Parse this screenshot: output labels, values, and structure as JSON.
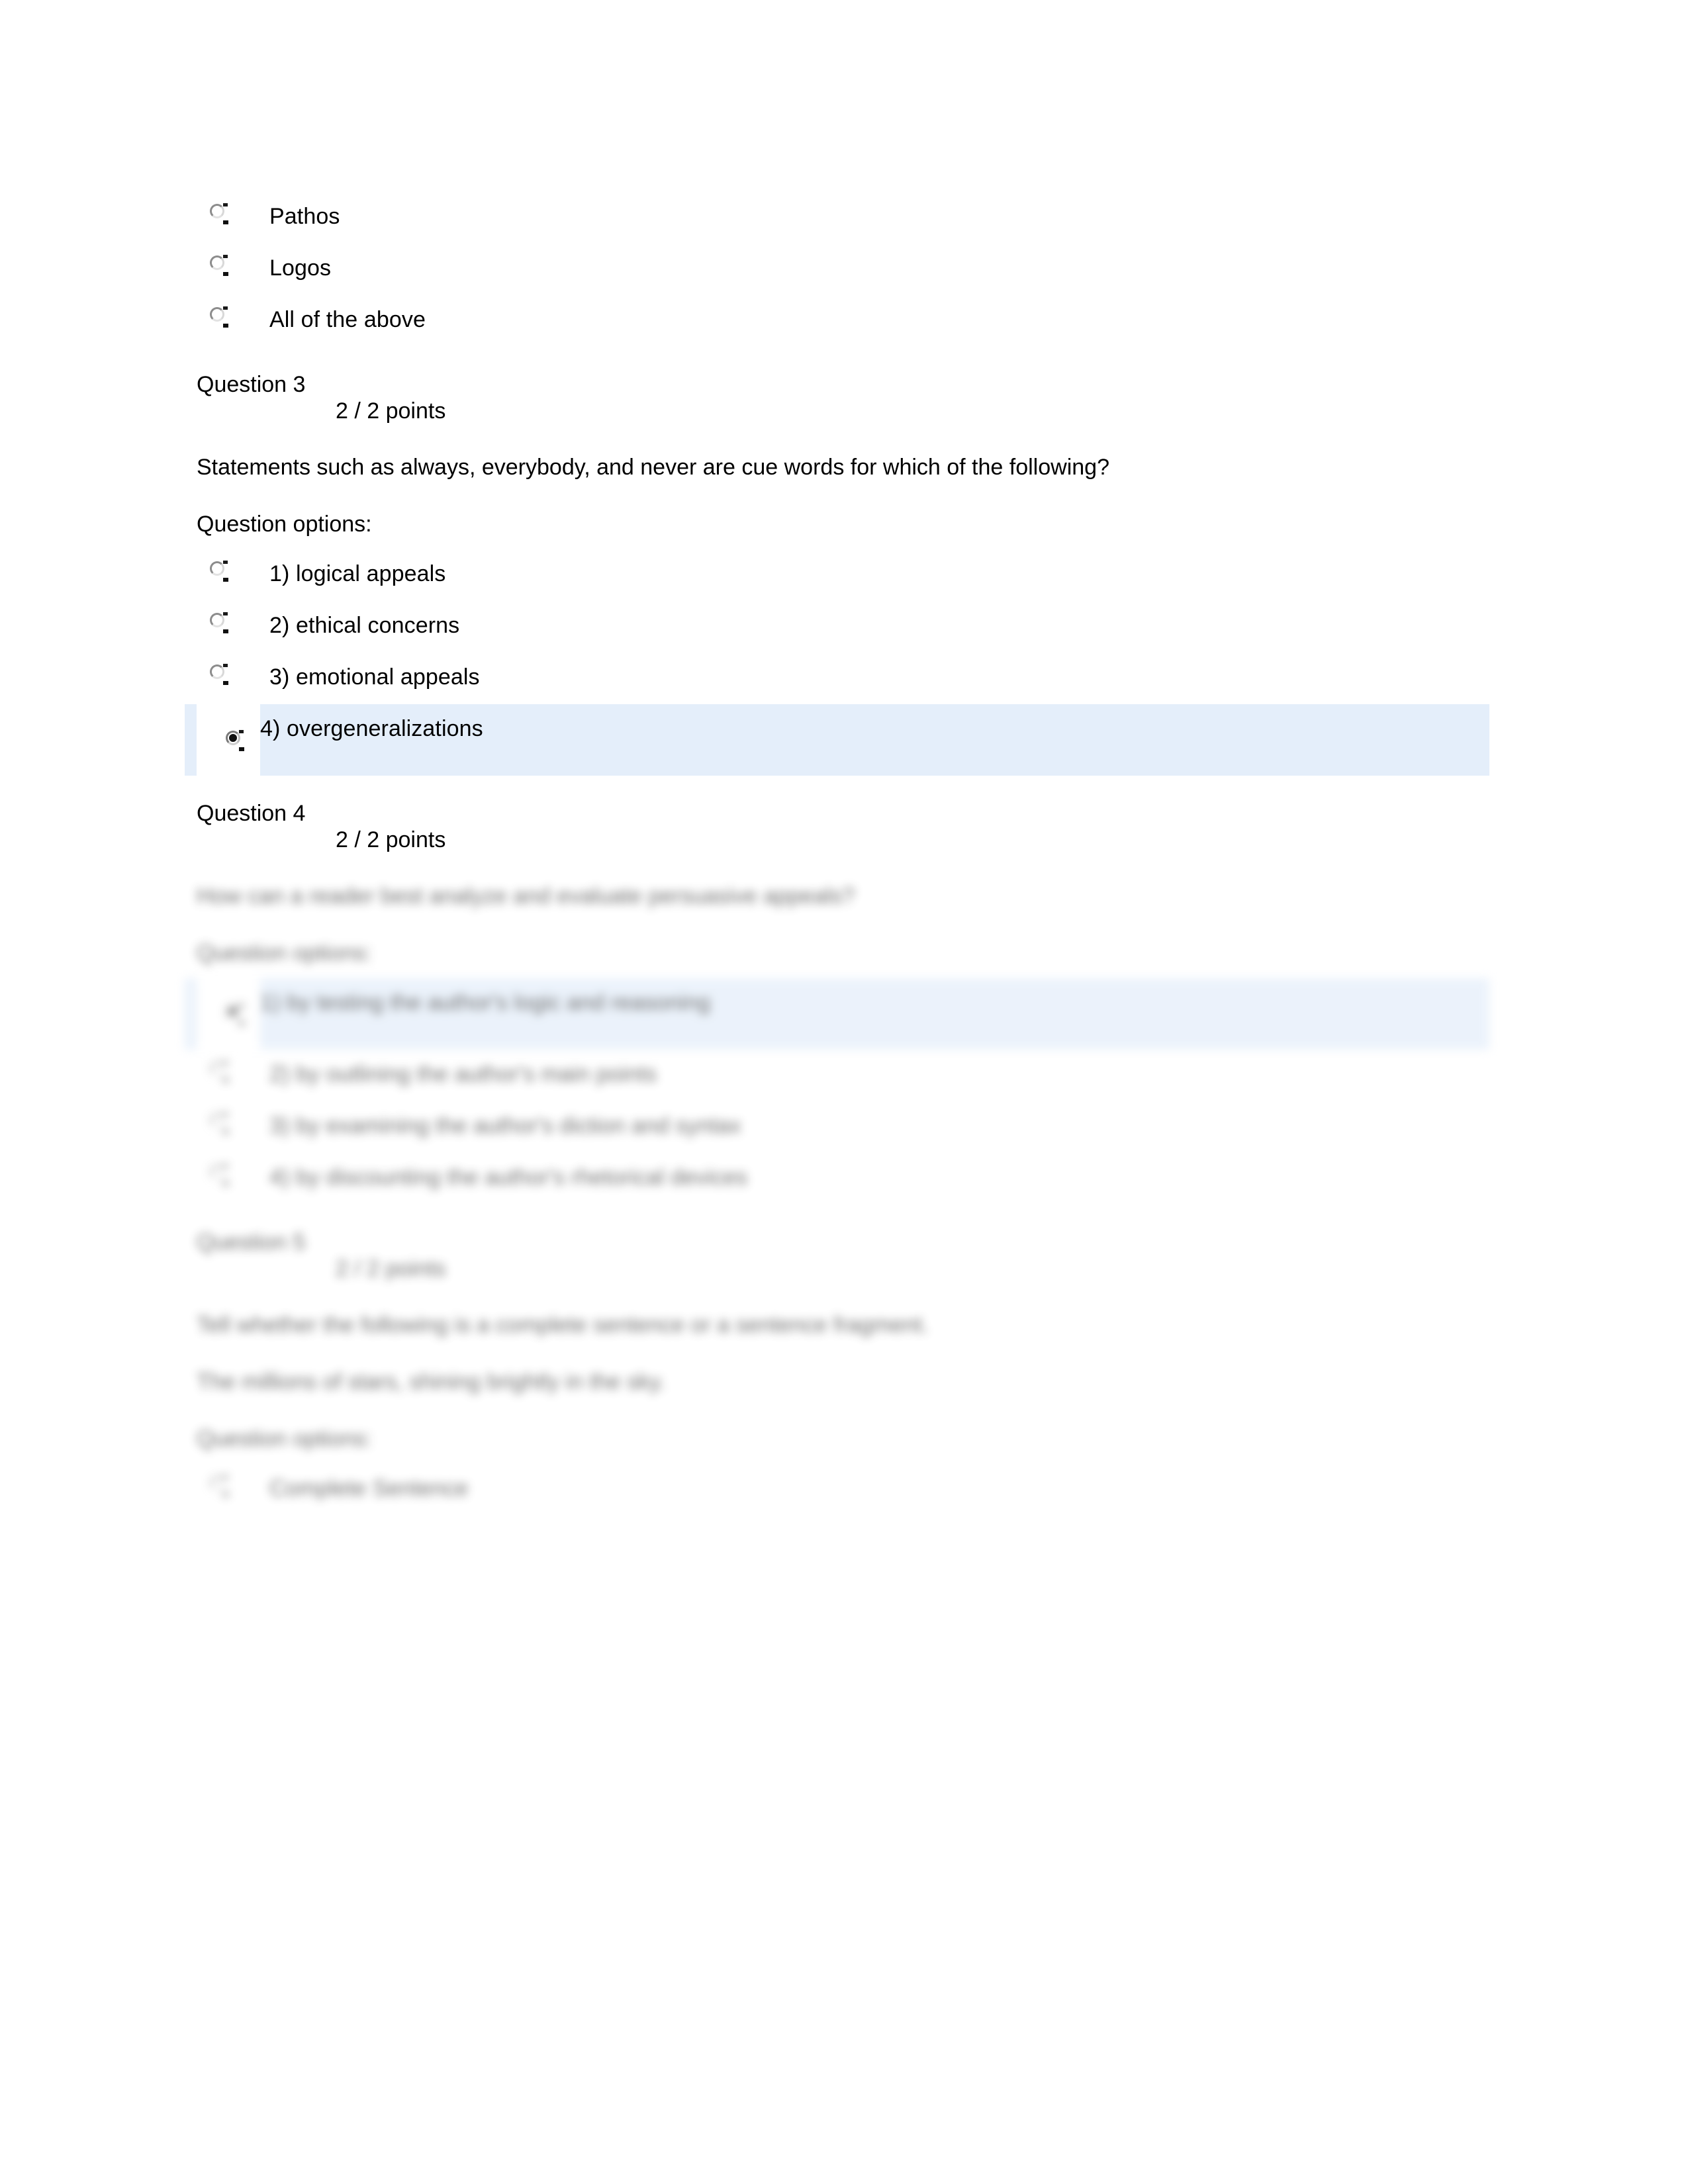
{
  "document": {
    "type": "quiz-review",
    "page_background": "#ffffff",
    "selected_row_highlight": "#e4eefa",
    "text_color": "#000000"
  },
  "top_options": {
    "items": [
      {
        "label": "Pathos",
        "state": "unselected",
        "icon": "radio-unchecked-icon"
      },
      {
        "label": "Logos",
        "state": "unselected",
        "icon": "radio-unchecked-icon"
      },
      {
        "label": "All of the above",
        "state": "unselected",
        "icon": "radio-unchecked-icon"
      }
    ]
  },
  "question3": {
    "number_label": "Question 3",
    "points": "2 / 2 points",
    "text": "Statements such as always, everybody, and never are cue words for which of the following?",
    "options_label": "Question options:",
    "options": [
      {
        "label": "1)  logical appeals",
        "state": "unselected",
        "icon": "radio-unchecked-icon"
      },
      {
        "label": "2)  ethical concerns",
        "state": "unselected",
        "icon": "radio-unchecked-icon"
      },
      {
        "label": "3)  emotional appeals",
        "state": "unselected",
        "icon": "radio-unchecked-icon"
      },
      {
        "label": "4)  overgeneralizations",
        "state": "selected",
        "icon": "radio-checked-icon"
      }
    ]
  },
  "question4": {
    "number_label": "Question 4",
    "points": "2 / 2 points",
    "text": "How can a reader best analyze and evaluate persuasive appeals?",
    "options_label": "Question options:",
    "blurred": true,
    "options": [
      {
        "label": "1)  by testing the author's logic and reasoning",
        "state": "selected",
        "icon": "radio-checked-icon"
      },
      {
        "label": "2)  by outlining the author's main points",
        "state": "unselected",
        "icon": "radio-unchecked-icon"
      },
      {
        "label": "3)  by examining the author's diction and syntax",
        "state": "unselected",
        "icon": "radio-unchecked-icon"
      },
      {
        "label": "4)  by discounting the author's rhetorical devices",
        "state": "unselected",
        "icon": "radio-unchecked-icon"
      }
    ]
  },
  "question5": {
    "number_label": "Question 5",
    "points": "2 / 2 points",
    "text": "Tell whether the following is a complete sentence or a sentence fragment.",
    "subtext": "The millions of stars, shining brightly in the sky.",
    "options_label": "Question options:",
    "blurred": true,
    "options": [
      {
        "label": "Complete Sentence",
        "state": "unselected",
        "icon": "radio-unchecked-icon"
      }
    ]
  }
}
